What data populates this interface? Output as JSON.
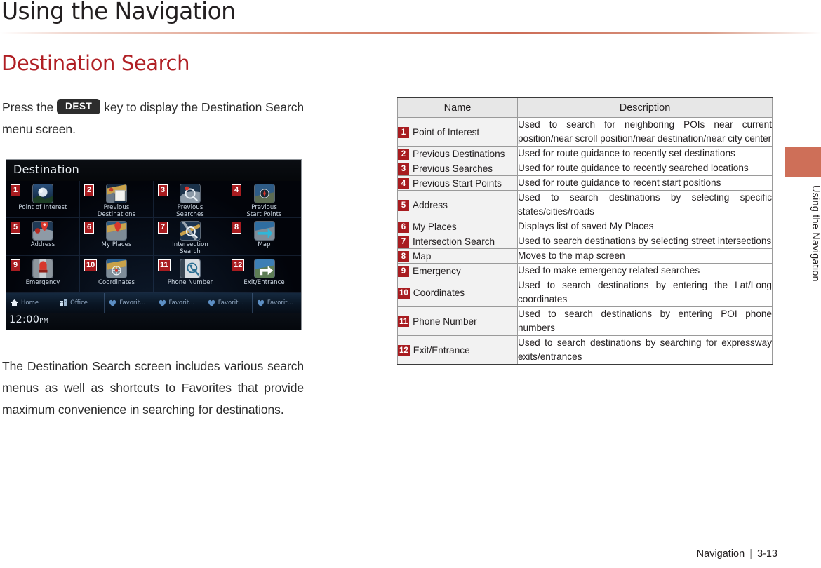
{
  "header": {
    "title": "Using the Navigation"
  },
  "section": {
    "title": "Destination Search"
  },
  "left": {
    "intro_before": "Press the",
    "dest_key": "DEST",
    "intro_after": "key to display the Destination Search menu screen.",
    "paragraph2": "The Destination Search screen includes various search menus as well as shortcuts to Favorites that provide maximum convenience in searching for destinations."
  },
  "nav_screen": {
    "title": "Destination",
    "clock_time": "12:00",
    "clock_ampm": "PM",
    "items": [
      {
        "num": "1",
        "label": "Point of Interest",
        "icon": "poi-icon"
      },
      {
        "num": "2",
        "label": "Previous\nDestinations",
        "icon": "previous-destinations-icon"
      },
      {
        "num": "3",
        "label": "Previous\nSearches",
        "icon": "previous-searches-icon"
      },
      {
        "num": "4",
        "label": "Previous\nStart Points",
        "icon": "previous-start-points-icon"
      },
      {
        "num": "5",
        "label": "Address",
        "icon": "address-icon"
      },
      {
        "num": "6",
        "label": "My Places",
        "icon": "my-places-icon"
      },
      {
        "num": "7",
        "label": "Intersection\nSearch",
        "icon": "intersection-search-icon"
      },
      {
        "num": "8",
        "label": "Map",
        "icon": "map-icon"
      },
      {
        "num": "9",
        "label": "Emergency",
        "icon": "emergency-icon"
      },
      {
        "num": "10",
        "label": "Coordinates",
        "icon": "coordinates-icon"
      },
      {
        "num": "11",
        "label": "Phone Number",
        "icon": "phone-number-icon"
      },
      {
        "num": "12",
        "label": "Exit/Entrance",
        "icon": "exit-entrance-icon"
      }
    ],
    "shortcuts": [
      {
        "label": "Home",
        "icon": "home-icon"
      },
      {
        "label": "Office",
        "icon": "office-icon"
      },
      {
        "label": "Favorit...",
        "icon": "heart-icon"
      },
      {
        "label": "Favorit...",
        "icon": "heart-icon"
      },
      {
        "label": "Favorit...",
        "icon": "heart-icon"
      },
      {
        "label": "Favorit...",
        "icon": "heart-icon"
      }
    ]
  },
  "table": {
    "headers": {
      "name": "Name",
      "description": "Description"
    },
    "rows": [
      {
        "num": "1",
        "name": "Point of Interest",
        "description": "Used to search for neighboring POIs near current position/near scroll position/near destination/near city center"
      },
      {
        "num": "2",
        "name": "Previous Destinations",
        "description": "Used for route guidance to recently set destinations"
      },
      {
        "num": "3",
        "name": "Previous Searches",
        "description": "Used for route guidance to recently searched locations"
      },
      {
        "num": "4",
        "name": "Previous Start Points",
        "description": "Used for route guidance to recent start positions"
      },
      {
        "num": "5",
        "name": "Address",
        "description": "Used to search destinations by selecting specific states/cities/roads"
      },
      {
        "num": "6",
        "name": "My Places",
        "description": "Displays list of saved My Places"
      },
      {
        "num": "7",
        "name": "Intersection Search",
        "description": "Used to search destinations by selecting street intersections"
      },
      {
        "num": "8",
        "name": "Map",
        "description": "Moves to the map screen"
      },
      {
        "num": "9",
        "name": "Emergency",
        "description": "Used to make emergency related searches"
      },
      {
        "num": "10",
        "name": "Coordinates",
        "description": "Used to search destinations by entering the Lat/Long coordinates"
      },
      {
        "num": "11",
        "name": "Phone Number",
        "description": "Used to search destinations by entering POI phone numbers"
      },
      {
        "num": "12",
        "name": "Exit/Entrance",
        "description": "Used to search destinations by searching for expressway exits/entrances"
      }
    ]
  },
  "side_tab": {
    "label": "Using the Navigation"
  },
  "footer": {
    "section": "Navigation",
    "separator": "|",
    "page": "3-13"
  },
  "colors": {
    "accent_red": "#b01f24",
    "badge_red": "#a81c20",
    "rule_terracotta": "#cc6b55",
    "tab_terracotta": "#ce6f58"
  }
}
